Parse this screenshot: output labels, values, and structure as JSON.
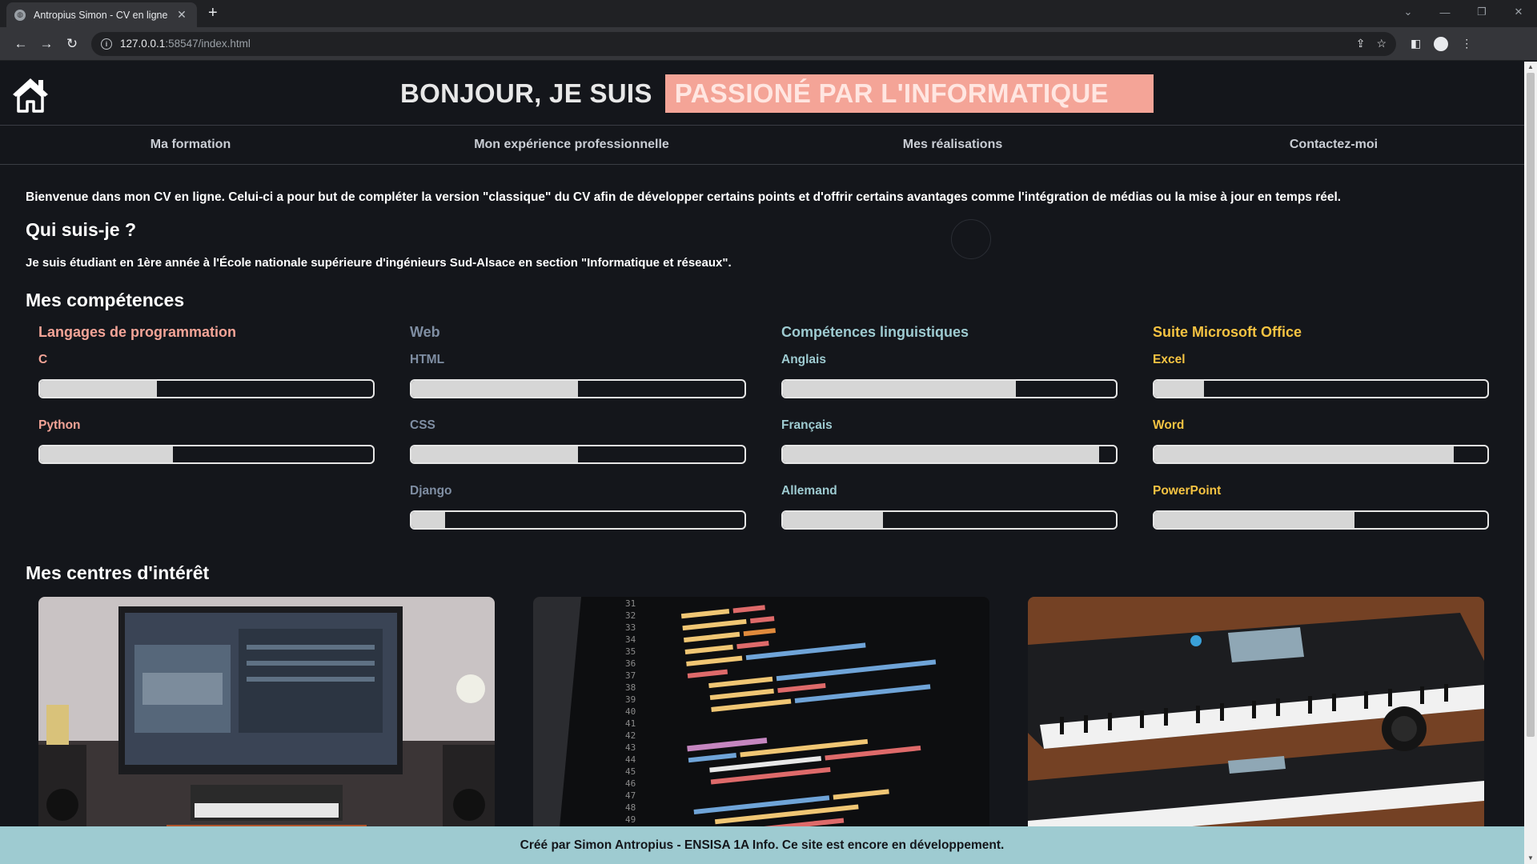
{
  "browser": {
    "tab_title": "Antropius Simon - CV en ligne",
    "url_host": "127.0.0.1",
    "url_rest": ":58547/index.html"
  },
  "header": {
    "hello": "BONJOUR, JE SUIS",
    "tagline": "PASSIONÉ PAR L'INFORMATIQUE",
    "highlight_color": "#f4a497"
  },
  "nav": [
    "Ma formation",
    "Mon expérience professionnelle",
    "Mes réalisations",
    "Contactez-moi"
  ],
  "intro": "Bienvenue dans mon CV en ligne. Celui-ci a pour but de compléter la version \"classique\" du CV afin de développer certains points et d'offrir certains avantages comme l'intégration de médias ou la mise à jour en temps réel.",
  "about": {
    "title": "Qui suis-je ?",
    "text": "Je suis étudiant en 1ère année à l'École nationale supérieure d'ingénieurs Sud-Alsace en section \"Informatique et réseaux\"."
  },
  "skills": {
    "title": "Mes compétences",
    "categories": [
      {
        "title": "Langages de programmation",
        "color": "#f4a497",
        "items": [
          {
            "name": "C",
            "level": 0.35
          },
          {
            "name": "Python",
            "level": 0.4
          }
        ]
      },
      {
        "title": "Web",
        "color": "#7f8ea3",
        "items": [
          {
            "name": "HTML",
            "level": 0.5
          },
          {
            "name": "CSS",
            "level": 0.5
          },
          {
            "name": "Django",
            "level": 0.1
          }
        ]
      },
      {
        "title": "Compétences linguistiques",
        "color": "#9ecbd1",
        "items": [
          {
            "name": "Anglais",
            "level": 0.7
          },
          {
            "name": "Français",
            "level": 0.95
          },
          {
            "name": "Allemand",
            "level": 0.3
          }
        ]
      },
      {
        "title": "Suite Microsoft Office",
        "color": "#f5c342",
        "items": [
          {
            "name": "Excel",
            "level": 0.15
          },
          {
            "name": "Word",
            "level": 0.9
          },
          {
            "name": "PowerPoint",
            "level": 0.6
          }
        ]
      }
    ]
  },
  "interests": {
    "title": "Mes centres d'intérêt",
    "photos": [
      "music-studio-photo",
      "code-screen-photo",
      "synthesizer-keyboards-photo"
    ]
  },
  "footer": "Créé par Simon Antropius - ENSISA 1A Info. Ce site est encore en développement."
}
